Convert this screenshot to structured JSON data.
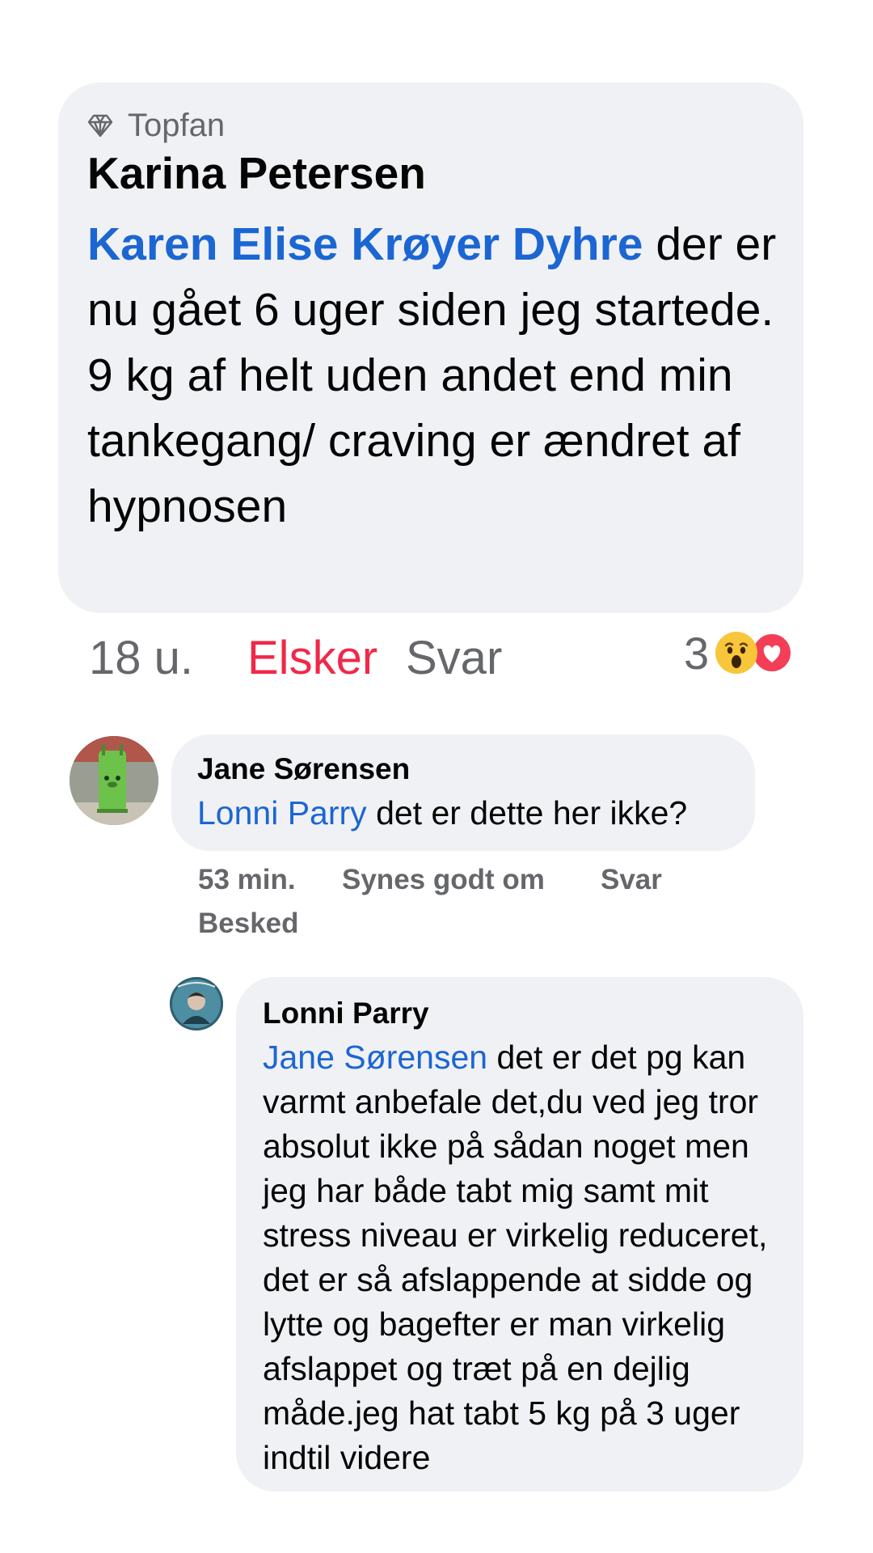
{
  "comment": {
    "badge": "Topfan",
    "badge_icon": "diamond-icon",
    "author": "Karina Petersen",
    "mention": "Karen Elise Krøyer Dyhre",
    "text": " der er nu gået 6 uger siden jeg startede. 9 kg af helt uden andet end min tankegang/ craving er ændret af hypnosen",
    "age": "18 u.",
    "reaction_label": "Elsker",
    "reply_label": "Svar",
    "reaction_count": "3",
    "reaction_icons": [
      "wow-emoji-icon",
      "love-heart-icon"
    ],
    "colors": {
      "mention": "#1b66d2",
      "love": "#f02849",
      "bubble": "#f0f1f4",
      "meta": "#65676b"
    }
  },
  "reply1": {
    "author": "Jane Sørensen",
    "mention": "Lonni Parry",
    "text": " det er dette her ikke?",
    "age": "53 min.",
    "like_label": "Synes godt om",
    "reply_label": "Svar",
    "message_label": "Besked"
  },
  "reply2": {
    "author": "Lonni Parry",
    "mention": "Jane Sørensen",
    "text": " det er det pg kan varmt anbefale det,du ved jeg tror absolut ikke på sådan noget men jeg har både tabt mig samt mit stress niveau er virkelig reduceret, det er så afslappende at sidde og lytte og bagefter er man virkelig afslappet og træt på en dejlig måde.jeg hat tabt 5 kg på 3 uger indtil videre"
  }
}
